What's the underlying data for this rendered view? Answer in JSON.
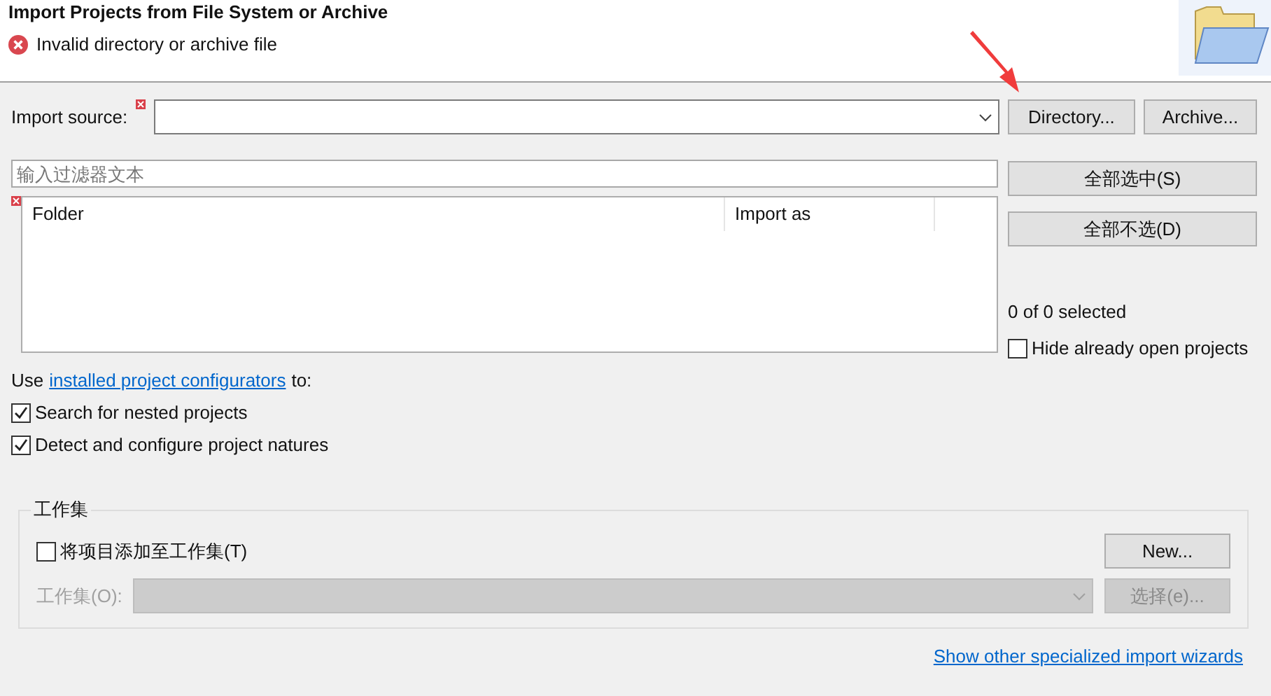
{
  "header": {
    "title": "Import Projects from File System or Archive",
    "message": {
      "kind": "error",
      "text": "Invalid directory or archive file"
    }
  },
  "import_source": {
    "label": "Import source:",
    "error": true
  },
  "source_buttons": [
    "Directory...",
    "Archive..."
  ],
  "filter": {
    "placeholder": "输入过滤器文本"
  },
  "table": {
    "error": true,
    "columns": [
      "Folder",
      "Import as"
    ]
  },
  "selection_buttons": [
    "全部选中(S)",
    "全部不选(D)"
  ],
  "selection_count": "0 of 0 selected",
  "hide_open": {
    "label": "Hide already open projects",
    "checked": false
  },
  "configurators": {
    "prefix": "Use",
    "link": "installed project configurators",
    "suffix": "to:"
  },
  "options": [
    {
      "label": "Search for nested projects",
      "checked": true
    },
    {
      "label": "Detect and configure project natures",
      "checked": true
    }
  ],
  "working_sets": {
    "title": "工作集",
    "add": {
      "label": "将项目添加至工作集(T)",
      "checked": false
    },
    "new_button": "New...",
    "select_label": "工作集(O):",
    "disabled": true,
    "select_button": "选择(e)..."
  },
  "footer_link": "Show other specialized import wizards",
  "annotation": {
    "kind": "arrow"
  }
}
